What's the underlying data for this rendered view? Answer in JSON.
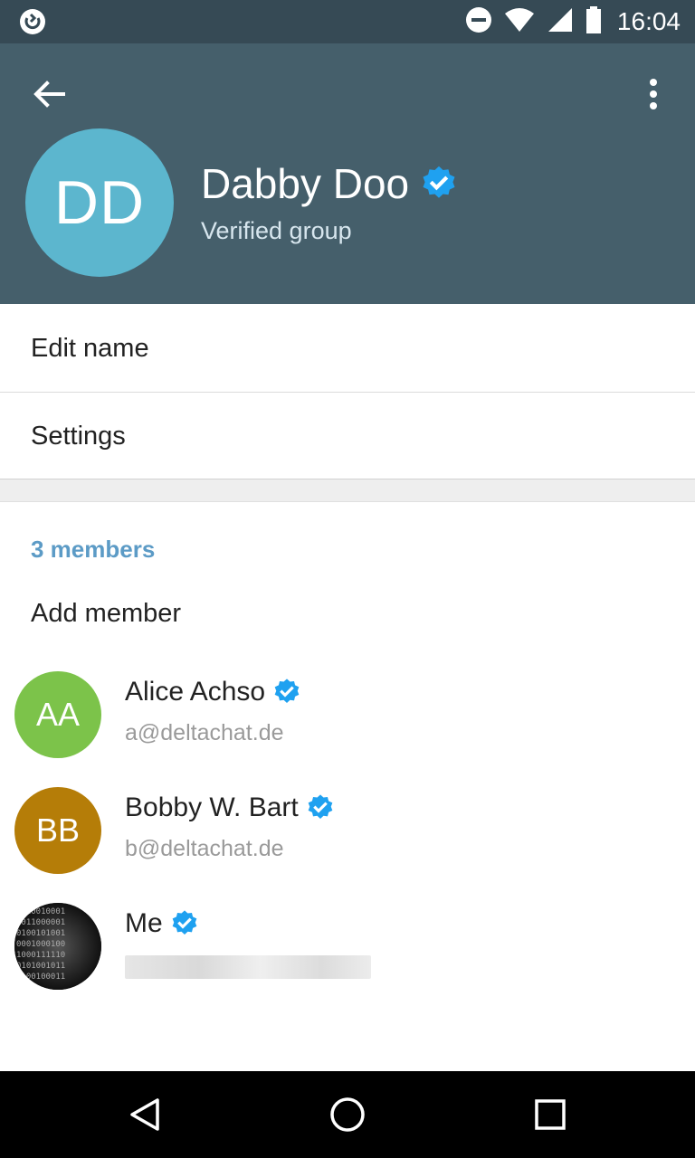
{
  "status_bar": {
    "time": "16:04",
    "icons": [
      "app-notification-icon",
      "do-not-disturb-icon",
      "wifi-icon",
      "signal-icon",
      "battery-icon"
    ]
  },
  "header": {
    "avatar_initials": "DD",
    "avatar_color": "#5cb6ce",
    "title": "Dabby Doo",
    "subtitle": "Verified group",
    "background": "#455f6b"
  },
  "menu": {
    "edit_name": "Edit name",
    "settings": "Settings"
  },
  "members": {
    "header": "3 members",
    "add_member": "Add member",
    "list": [
      {
        "initials": "AA",
        "name": "Alice Achso",
        "address": "a@deltachat.de",
        "color": "#7cc34a",
        "verified": true
      },
      {
        "initials": "BB",
        "name": "Bobby W. Bart",
        "address": "b@deltachat.de",
        "color": "#b57d08",
        "verified": true
      },
      {
        "initials": "",
        "name": "Me",
        "address": "",
        "color": "#1b1b1b",
        "verified": true
      }
    ]
  },
  "colors": {
    "verified": "#1fa1f0",
    "accent": "#5c9bc6",
    "status_bar": "#364a55"
  }
}
